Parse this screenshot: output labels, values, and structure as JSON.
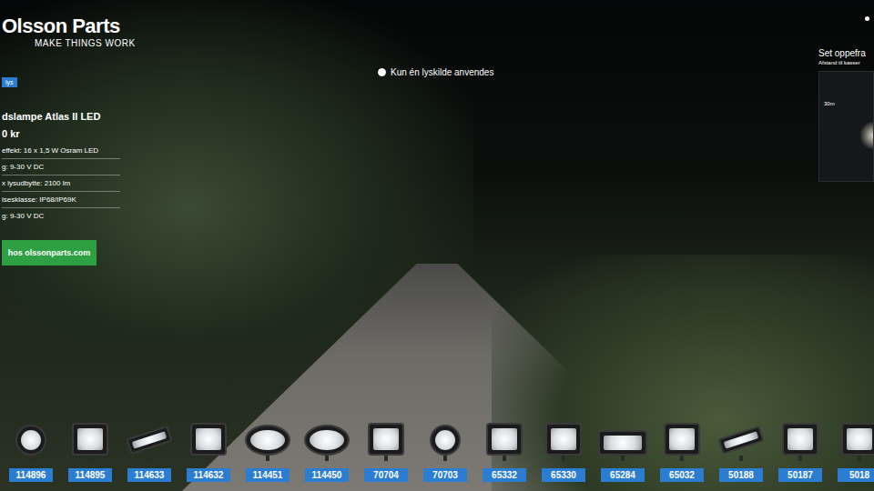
{
  "logo": {
    "name": "Olsson Parts",
    "tagline": "MAKE THINGS WORK"
  },
  "product": {
    "badge": "lys",
    "title": "dslampe Atlas II LED",
    "price": "0 kr",
    "specs": [
      "effekt: 16 x 1,5 W Osram LED",
      "g: 9-30 V DC",
      "x lysudbytte: 2100 lm",
      "lsesklasse: IP68/IP69K",
      "g: 9-30 V DC"
    ],
    "button": "hos olssonparts.com"
  },
  "light_option": {
    "label": "Kun én lyskilde anvendes",
    "selected": true
  },
  "view": {
    "title": "Set oppefra",
    "subtitle": "Afstand til kasser",
    "distance": "30m"
  },
  "lamps": [
    {
      "code": "114896",
      "kind": "round"
    },
    {
      "code": "114895",
      "kind": "square"
    },
    {
      "code": "114633",
      "kind": "bar"
    },
    {
      "code": "114632",
      "kind": "square"
    },
    {
      "code": "114451",
      "kind": "oval"
    },
    {
      "code": "114450",
      "kind": "oval"
    },
    {
      "code": "70704",
      "kind": "square"
    },
    {
      "code": "70703",
      "kind": "round"
    },
    {
      "code": "65332",
      "kind": "square"
    },
    {
      "code": "65330",
      "kind": "square"
    },
    {
      "code": "65284",
      "kind": "wide"
    },
    {
      "code": "65032",
      "kind": "square"
    },
    {
      "code": "50188",
      "kind": "bar"
    },
    {
      "code": "50187",
      "kind": "square"
    },
    {
      "code": "5018",
      "kind": "square"
    }
  ]
}
